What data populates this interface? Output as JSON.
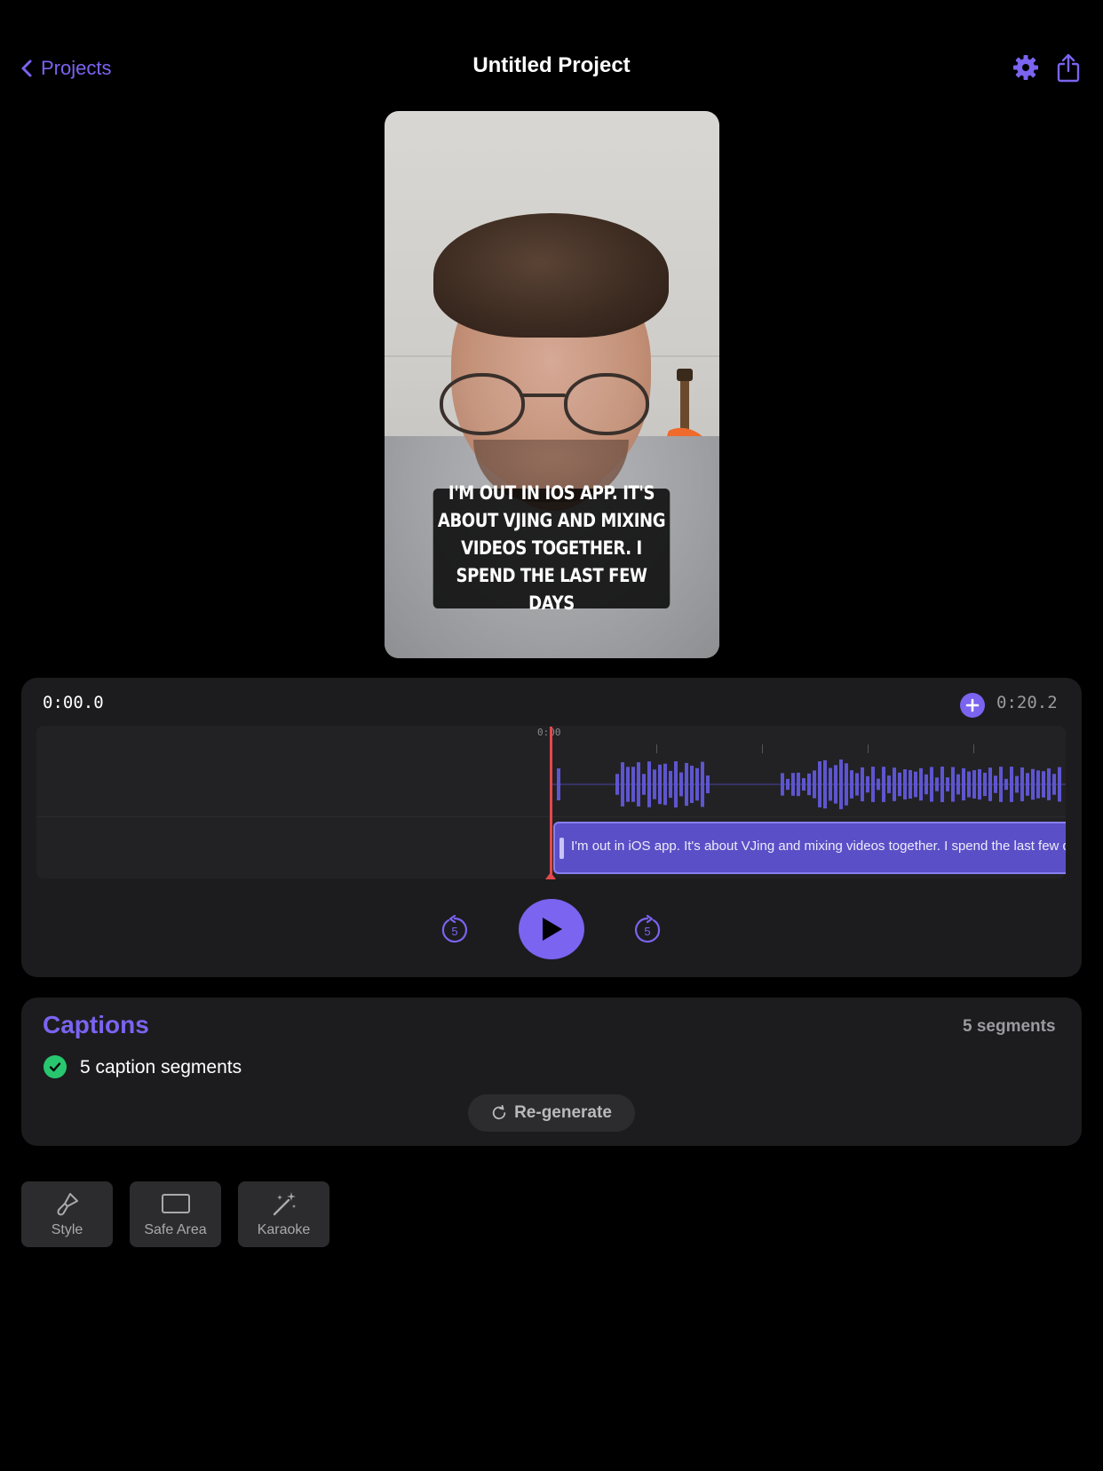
{
  "header": {
    "back_label": "Projects",
    "title": "Untitled Project",
    "settings_icon": "gear-icon",
    "share_icon": "share-icon"
  },
  "preview": {
    "caption_overlay": "I'M OUT IN IOS APP. IT'S ABOUT VJING AND MIXING VIDEOS TOGETHER. I SPEND THE LAST FEW DAYS"
  },
  "timeline": {
    "current_time": "0:00.0",
    "total_time": "0:20.2",
    "ruler_label": "0:00",
    "segment_text": "I'm out in iOS app. It's about VJing and mixing videos together. I spend the last few days",
    "skip_back_label": "5",
    "skip_forward_label": "5"
  },
  "captions": {
    "title": "Captions",
    "segment_count": "5 segments",
    "status_text": "5 caption segments",
    "regenerate_label": "Re-generate"
  },
  "tools": [
    {
      "label": "Style",
      "icon": "brush-icon"
    },
    {
      "label": "Safe Area",
      "icon": "rectangle-icon"
    },
    {
      "label": "Karaoke",
      "icon": "magic-wand-icon"
    }
  ],
  "colors": {
    "accent": "#7a64f0",
    "background": "#000000",
    "panel": "#1c1c1e",
    "playhead": "#e5484d",
    "success": "#28c76f"
  }
}
